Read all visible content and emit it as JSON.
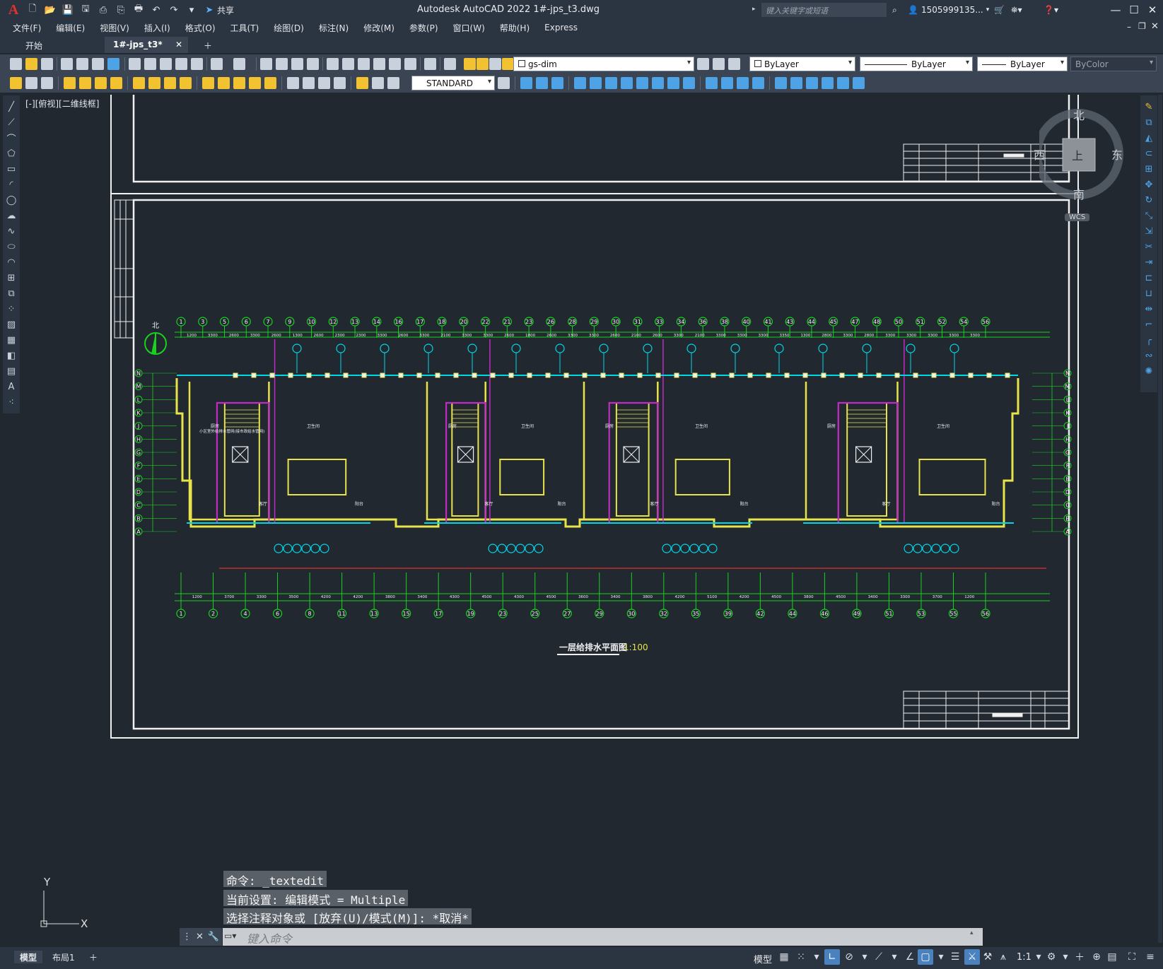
{
  "window": {
    "title": "Autodesk AutoCAD 2022    1#-jps_t3.dwg",
    "search_placeholder": "键入关键字或短语",
    "user": "1505999135...",
    "share_label": "共享"
  },
  "menu": [
    "文件(F)",
    "编辑(E)",
    "视图(V)",
    "插入(I)",
    "格式(O)",
    "工具(T)",
    "绘图(D)",
    "标注(N)",
    "修改(M)",
    "参数(P)",
    "窗口(W)",
    "帮助(H)",
    "Express"
  ],
  "tabs": [
    {
      "label": "开始",
      "active": false
    },
    {
      "label": "1#-jps_t3*",
      "active": true
    }
  ],
  "properties": {
    "layer": "gs-dim",
    "color": "ByLayer",
    "linetype": "ByLayer",
    "lineweight": "ByLayer",
    "plotstyle": "ByColor",
    "text_style": "STANDARD"
  },
  "viewport": {
    "label": "[-][俯视][二维线框]",
    "compass": {
      "north": "北",
      "south": "南",
      "east": "东",
      "west": "西",
      "top": "上",
      "ucs": "WCS"
    }
  },
  "drawing": {
    "caption": "一层给排水平面图",
    "scale": "1:100",
    "north_label": "北",
    "top_grid": [
      "1",
      "3",
      "5",
      "6",
      "7",
      "9",
      "10",
      "12",
      "13",
      "14",
      "16",
      "17",
      "18",
      "20",
      "22",
      "21",
      "23",
      "26",
      "28",
      "29",
      "30",
      "31",
      "33",
      "34",
      "36",
      "38",
      "40",
      "41",
      "43",
      "44",
      "45",
      "47",
      "48",
      "50",
      "51",
      "52",
      "54",
      "56"
    ],
    "bottom_grid": [
      "1",
      "2",
      "4",
      "6",
      "8",
      "11",
      "13",
      "15",
      "17",
      "19",
      "23",
      "25",
      "27",
      "29",
      "30",
      "32",
      "35",
      "39",
      "42",
      "44",
      "46",
      "49",
      "51",
      "53",
      "55",
      "56"
    ],
    "side_grid_left": [
      "N",
      "M",
      "L",
      "K",
      "J",
      "H",
      "G",
      "F",
      "E",
      "D",
      "C",
      "B",
      "A"
    ],
    "side_grid_right": [
      "N",
      "M",
      "L",
      "K",
      "J",
      "H",
      "G",
      "F",
      "E",
      "D",
      "C",
      "B",
      "A"
    ],
    "top_dims": [
      "1200",
      "3300",
      "2600",
      "3300",
      "2600",
      "1300",
      "2600",
      "2300",
      "2300",
      "3300",
      "2600",
      "3300",
      "2100",
      "3300",
      "3300",
      "2600",
      "1800",
      "2600",
      "3300",
      "3300",
      "2600",
      "2100",
      "2600",
      "3300",
      "2100",
      "3300",
      "3300",
      "3300",
      "3350",
      "1300",
      "2800",
      "3300",
      "2800",
      "3300",
      "3300",
      "3300",
      "3300",
      "3300"
    ],
    "bottom_dims": [
      "1200",
      "3700",
      "3300",
      "3500",
      "4200",
      "4200",
      "3800",
      "3400",
      "4300",
      "4500",
      "4300",
      "4500",
      "3600",
      "3400",
      "3800",
      "4200",
      "5100",
      "4200",
      "4500",
      "3800",
      "4500",
      "3400",
      "3300",
      "3700",
      "1200"
    ],
    "room_labels": [
      "厨房",
      "客厅",
      "卫生间",
      "阳台",
      "餐厅",
      "卧室",
      "电梯间",
      "住宅大堂",
      "电表间"
    ],
    "note": "小区室外给排水管网(接市政给水管网)"
  },
  "commandline": {
    "history": [
      "命令: _textedit",
      "当前设置: 编辑模式 = Multiple",
      "选择注释对象或 [放弃(U)/模式(M)]: *取消*"
    ],
    "placeholder": "键入命令"
  },
  "layouts": [
    {
      "label": "模型",
      "active": true
    },
    {
      "label": "布局1",
      "active": false
    }
  ],
  "status": {
    "model_label": "模型",
    "scale": "1:1"
  },
  "ucs_icon": {
    "x": "X",
    "y": "Y"
  },
  "colors": {
    "background": "#212830",
    "wall": "#e8e34a",
    "pipe_cyan": "#00d8e8",
    "pipe_magenta": "#c22ac6",
    "grid_green": "#19d21e",
    "dim_red": "#e03030",
    "accent": "#4a82c0"
  }
}
